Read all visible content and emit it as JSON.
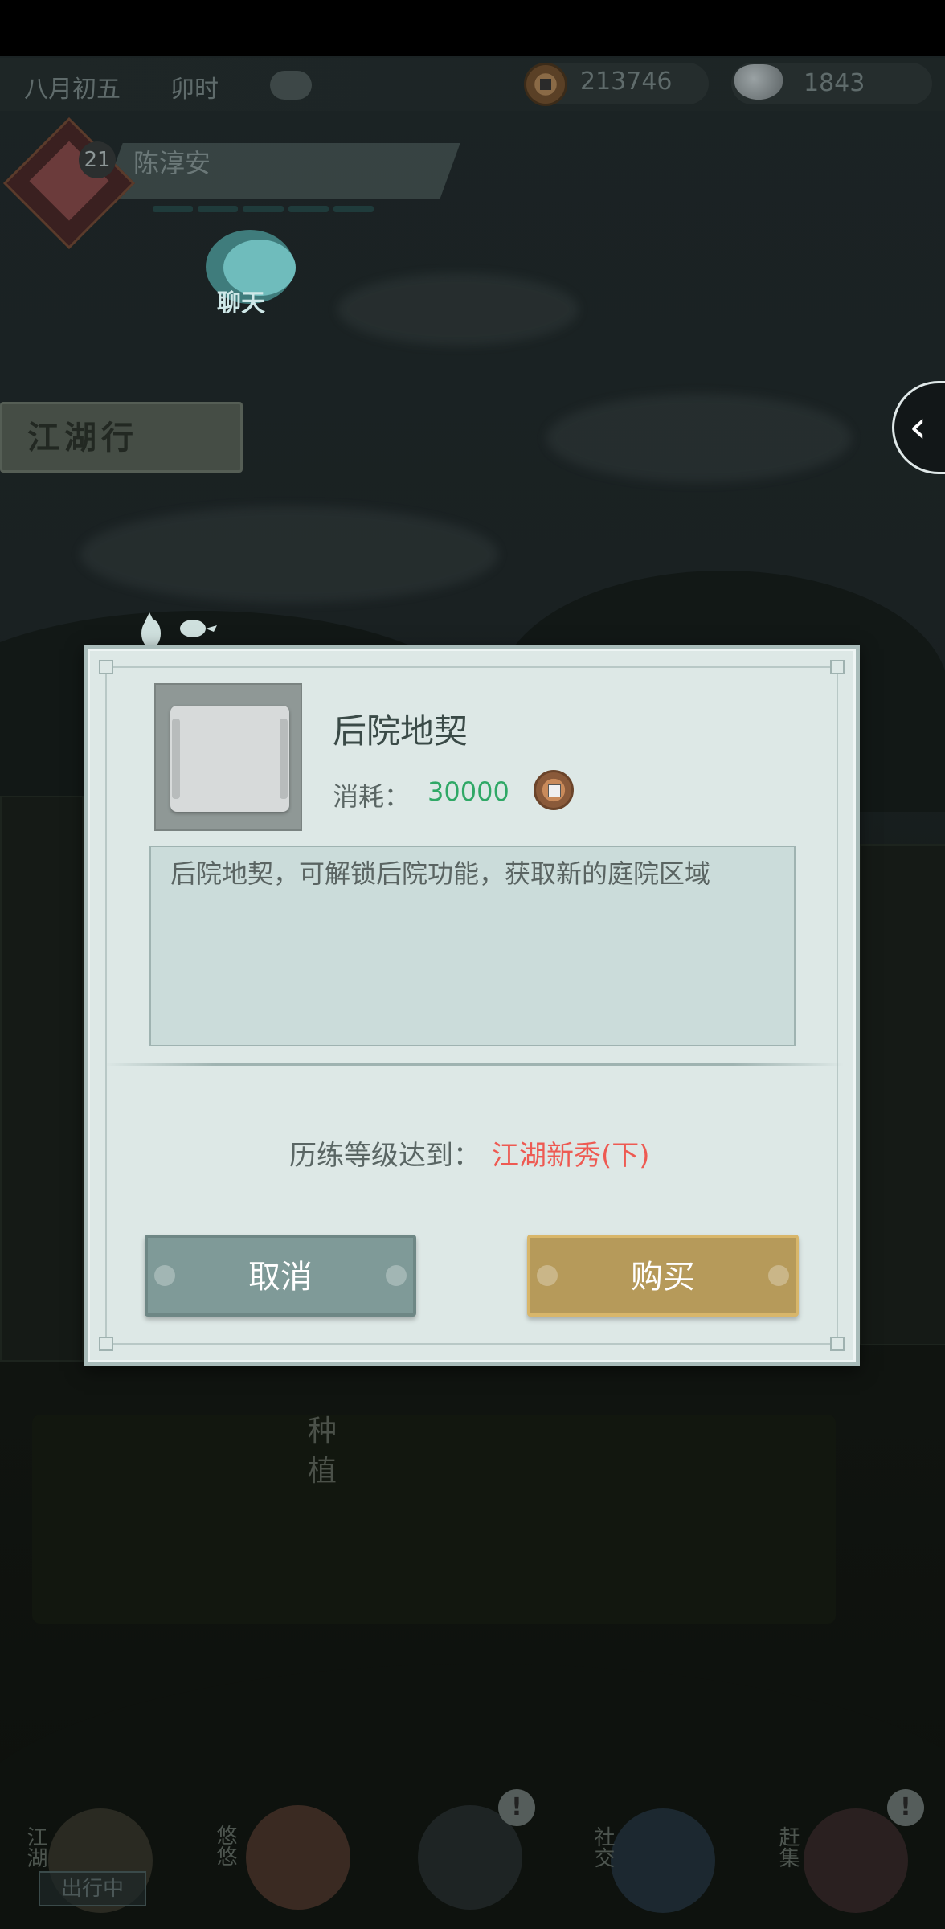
{
  "hud": {
    "date": "八月初五",
    "time": "卯时",
    "copper": "213746",
    "silver": "1843"
  },
  "player": {
    "level": "21",
    "name": "陈淳安"
  },
  "chat": {
    "label": "聊天"
  },
  "jianghu": {
    "label": "江湖行"
  },
  "planting": {
    "label": "种植"
  },
  "bottom_nav": {
    "jianghu": "江湖",
    "out_status": "出行中",
    "youyou": "悠悠",
    "social": "社交",
    "market": "赶集",
    "alert": "!"
  },
  "dialog": {
    "item_name": "后院地契",
    "cost_label": "消耗：",
    "cost_value": "30000",
    "description": "后院地契，可解锁后院功能，获取新的庭院区域",
    "requirement_label": "历练等级达到：",
    "requirement_value": "江湖新秀(下)",
    "cancel_label": "取消",
    "buy_label": "购买"
  },
  "colors": {
    "cost": "#2fa866",
    "requirement": "#ee5a52",
    "cancel_button": "#7f9a98",
    "buy_button": "#b69a5a"
  }
}
